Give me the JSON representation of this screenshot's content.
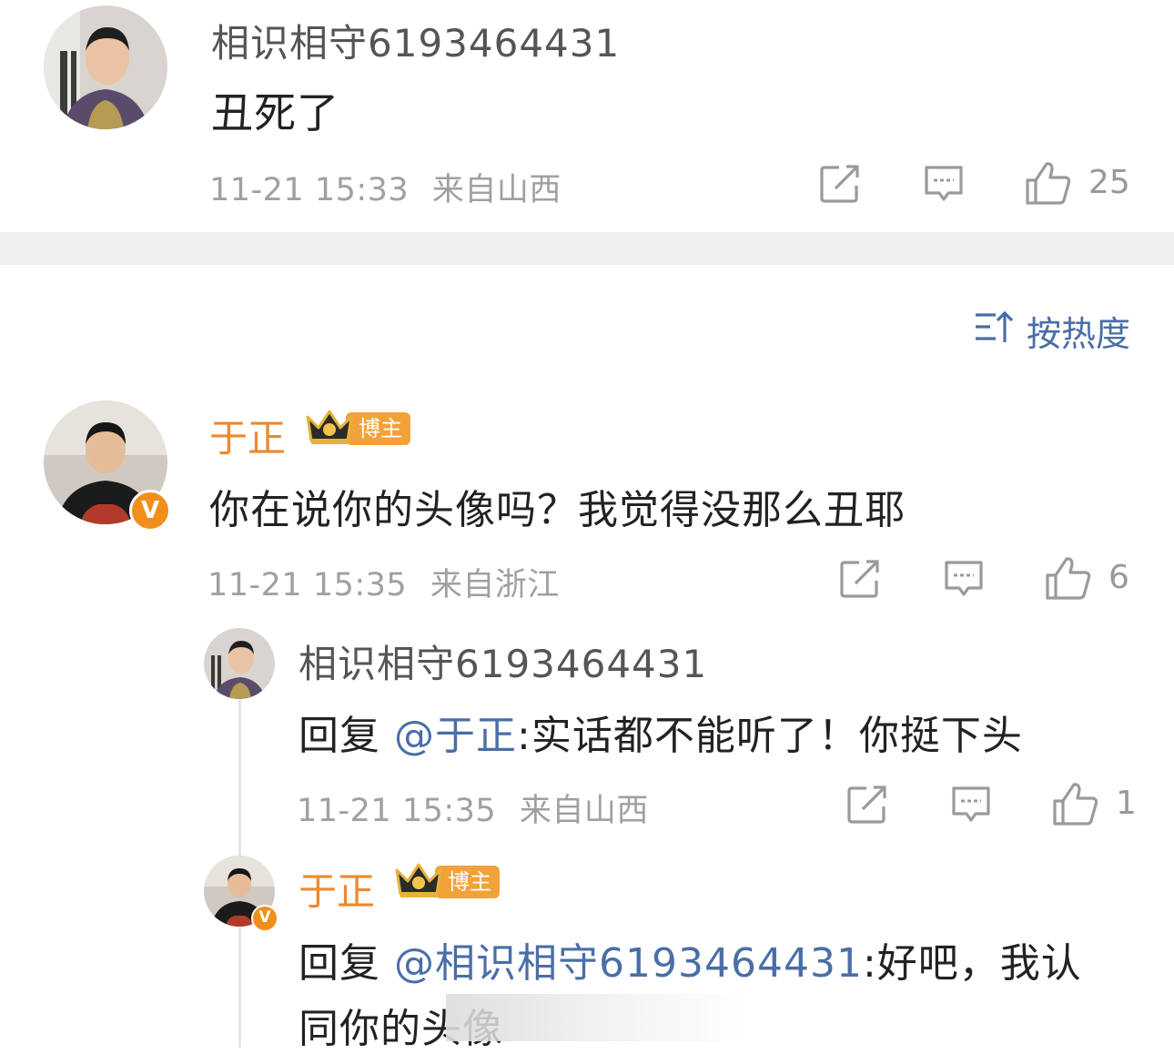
{
  "comments": [
    {
      "user": "相识相守6193464431",
      "content": "丑死了",
      "time": "11-21 15:33",
      "location": "来自山西",
      "likes": "25"
    }
  ],
  "sort": {
    "label": "按热度"
  },
  "thread": {
    "main": {
      "user": "于正",
      "badge": "博主",
      "content": "你在说你的头像吗？我觉得没那么丑耶",
      "time": "11-21 15:35",
      "location": "来自浙江",
      "likes": "6",
      "verified_mark": "V"
    },
    "replies": [
      {
        "user": "相识相守6193464431",
        "reply_prefix": "回复 ",
        "mention": "@于正",
        "text": ":实话都不能听了！你挺下头",
        "time": "11-21 15:35",
        "location": "来自山西",
        "likes": "1"
      },
      {
        "user": "于正",
        "badge": "博主",
        "reply_prefix": "回复 ",
        "mention": "@相识相守6193464431",
        "text": ":好吧，我认",
        "text_line2": "同你的头像",
        "verified_mark": "V"
      }
    ]
  },
  "colors": {
    "username_orange": "#ec8a2e",
    "mention_blue": "#4a6ea6",
    "meta_gray": "#a0a0a0",
    "badge_orange": "#f2a23a"
  },
  "icons": [
    "share-icon",
    "comment-icon",
    "like-icon",
    "sort-icon",
    "crown-icon"
  ]
}
